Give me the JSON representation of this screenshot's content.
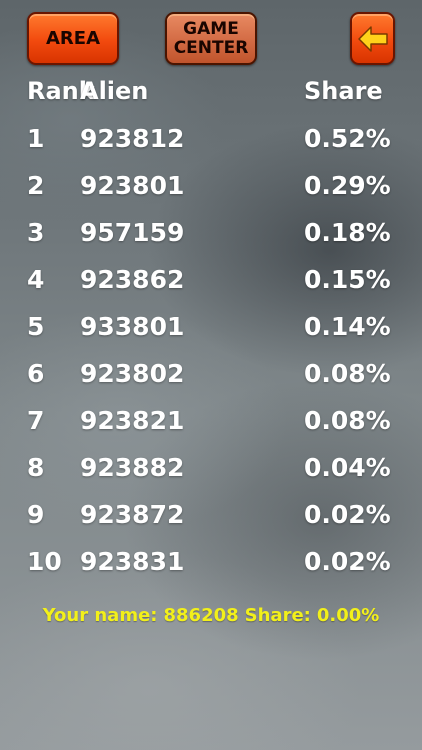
{
  "toolbar": {
    "area_label": "AREA",
    "game_center_line1": "GAME",
    "game_center_line2": "CENTER",
    "back_icon": "back-arrow-icon"
  },
  "colors": {
    "button_orange": "#f24a0e",
    "footer_yellow": "#f2f01a",
    "text_white": "#ffffff"
  },
  "table": {
    "headers": {
      "rank": "Rank",
      "alien": "Alien",
      "share": "Share"
    },
    "rows": [
      {
        "rank": "1",
        "alien": "923812",
        "share": "0.52%"
      },
      {
        "rank": "2",
        "alien": "923801",
        "share": "0.29%"
      },
      {
        "rank": "3",
        "alien": "957159",
        "share": "0.18%"
      },
      {
        "rank": "4",
        "alien": "923862",
        "share": "0.15%"
      },
      {
        "rank": "5",
        "alien": "933801",
        "share": "0.14%"
      },
      {
        "rank": "6",
        "alien": "923802",
        "share": "0.08%"
      },
      {
        "rank": "7",
        "alien": "923821",
        "share": "0.08%"
      },
      {
        "rank": "8",
        "alien": "923882",
        "share": "0.04%"
      },
      {
        "rank": "9",
        "alien": "923872",
        "share": "0.02%"
      },
      {
        "rank": "10",
        "alien": "923831",
        "share": "0.02%"
      }
    ]
  },
  "footer": {
    "your_name_label": "Your name:",
    "your_name_value": "886208",
    "share_label": "Share:",
    "share_value": "0.00%"
  }
}
